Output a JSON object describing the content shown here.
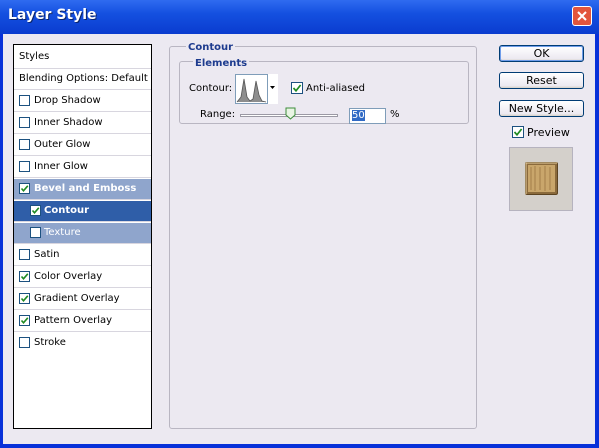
{
  "window": {
    "title": "Layer Style"
  },
  "styles_panel": {
    "header": "Styles",
    "blending": "Blending Options: Default",
    "items": [
      {
        "label": "Drop Shadow",
        "checked": false
      },
      {
        "label": "Inner Shadow",
        "checked": false
      },
      {
        "label": "Outer Glow",
        "checked": false
      },
      {
        "label": "Inner Glow",
        "checked": false
      },
      {
        "label": "Bevel and Emboss",
        "checked": true
      },
      {
        "label": "Contour",
        "checked": true
      },
      {
        "label": "Texture",
        "checked": false
      },
      {
        "label": "Satin",
        "checked": false
      },
      {
        "label": "Color Overlay",
        "checked": true
      },
      {
        "label": "Gradient Overlay",
        "checked": true
      },
      {
        "label": "Pattern Overlay",
        "checked": true
      },
      {
        "label": "Stroke",
        "checked": false
      }
    ]
  },
  "contour_section": {
    "title": "Contour",
    "elements_title": "Elements",
    "contour_label": "Contour:",
    "anti_aliased_label": "Anti-aliased",
    "anti_aliased_checked": true,
    "range_label": "Range:",
    "range_value": "50",
    "range_unit": "%",
    "range_fraction": 0.5
  },
  "buttons": {
    "ok": "OK",
    "reset": "Reset",
    "new_style": "New Style..."
  },
  "preview": {
    "label": "Preview",
    "checked": true
  },
  "colors": {
    "title_bar": "#0a3ccf",
    "selected_row": "#2f5ea8",
    "selected_group": "#8fa5cc",
    "check": "#1f8a22"
  }
}
